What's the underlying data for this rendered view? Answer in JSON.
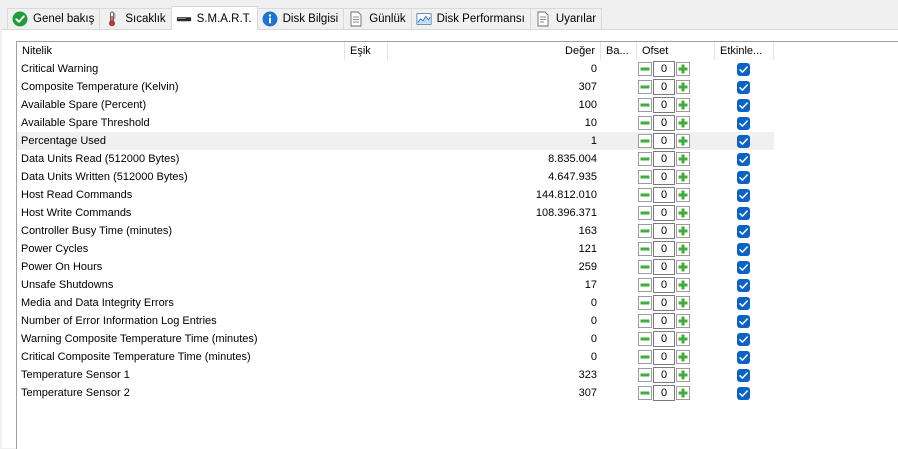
{
  "tabs": [
    {
      "label": "Genel bakış",
      "icon": "green-check-icon",
      "active": false
    },
    {
      "label": "Sıcaklık",
      "icon": "thermometer-icon",
      "active": false
    },
    {
      "label": "S.M.A.R.T.",
      "icon": "drive-icon",
      "active": true
    },
    {
      "label": "Disk Bilgisi",
      "icon": "info-icon",
      "active": false
    },
    {
      "label": "Günlük",
      "icon": "document-icon",
      "active": false
    },
    {
      "label": "Disk Performansı",
      "icon": "chart-icon",
      "active": false
    },
    {
      "label": "Uyarılar",
      "icon": "warning-document-icon",
      "active": false
    }
  ],
  "columns": {
    "attribute": "Nitelik",
    "threshold": "Eşik",
    "value": "Değer",
    "base": "Ba...",
    "offset": "Ofset",
    "enabled": "Etkinle..."
  },
  "rows": [
    {
      "name": "Critical Warning",
      "value": "0",
      "offset": "0",
      "enabled": true
    },
    {
      "name": "Composite Temperature (Kelvin)",
      "value": "307",
      "offset": "0",
      "enabled": true
    },
    {
      "name": "Available Spare (Percent)",
      "value": "100",
      "offset": "0",
      "enabled": true
    },
    {
      "name": "Available Spare Threshold",
      "value": "10",
      "offset": "0",
      "enabled": true
    },
    {
      "name": "Percentage Used",
      "value": "1",
      "offset": "0",
      "enabled": true,
      "highlighted": true
    },
    {
      "name": "Data Units Read (512000 Bytes)",
      "value": "8.835.004",
      "offset": "0",
      "enabled": true
    },
    {
      "name": "Data Units Written (512000 Bytes)",
      "value": "4.647.935",
      "offset": "0",
      "enabled": true
    },
    {
      "name": "Host Read Commands",
      "value": "144.812.010",
      "offset": "0",
      "enabled": true
    },
    {
      "name": "Host Write Commands",
      "value": "108.396.371",
      "offset": "0",
      "enabled": true
    },
    {
      "name": "Controller Busy Time (minutes)",
      "value": "163",
      "offset": "0",
      "enabled": true
    },
    {
      "name": "Power Cycles",
      "value": "121",
      "offset": "0",
      "enabled": true
    },
    {
      "name": "Power On Hours",
      "value": "259",
      "offset": "0",
      "enabled": true
    },
    {
      "name": "Unsafe Shutdowns",
      "value": "17",
      "offset": "0",
      "enabled": true
    },
    {
      "name": "Media and Data Integrity Errors",
      "value": "0",
      "offset": "0",
      "enabled": true
    },
    {
      "name": "Number of Error Information Log Entries",
      "value": "0",
      "offset": "0",
      "enabled": true
    },
    {
      "name": "Warning Composite Temperature Time (minutes)",
      "value": "0",
      "offset": "0",
      "enabled": true
    },
    {
      "name": "Critical Composite Temperature Time (minutes)",
      "value": "0",
      "offset": "0",
      "enabled": true
    },
    {
      "name": "Temperature Sensor 1",
      "value": "323",
      "offset": "0",
      "enabled": true
    },
    {
      "name": "Temperature Sensor 2",
      "value": "307",
      "offset": "0",
      "enabled": true
    }
  ],
  "colors": {
    "accent": "#0b63c5",
    "stepper_green": "#3cae3c",
    "row_highlight": "#f0f0f0"
  }
}
